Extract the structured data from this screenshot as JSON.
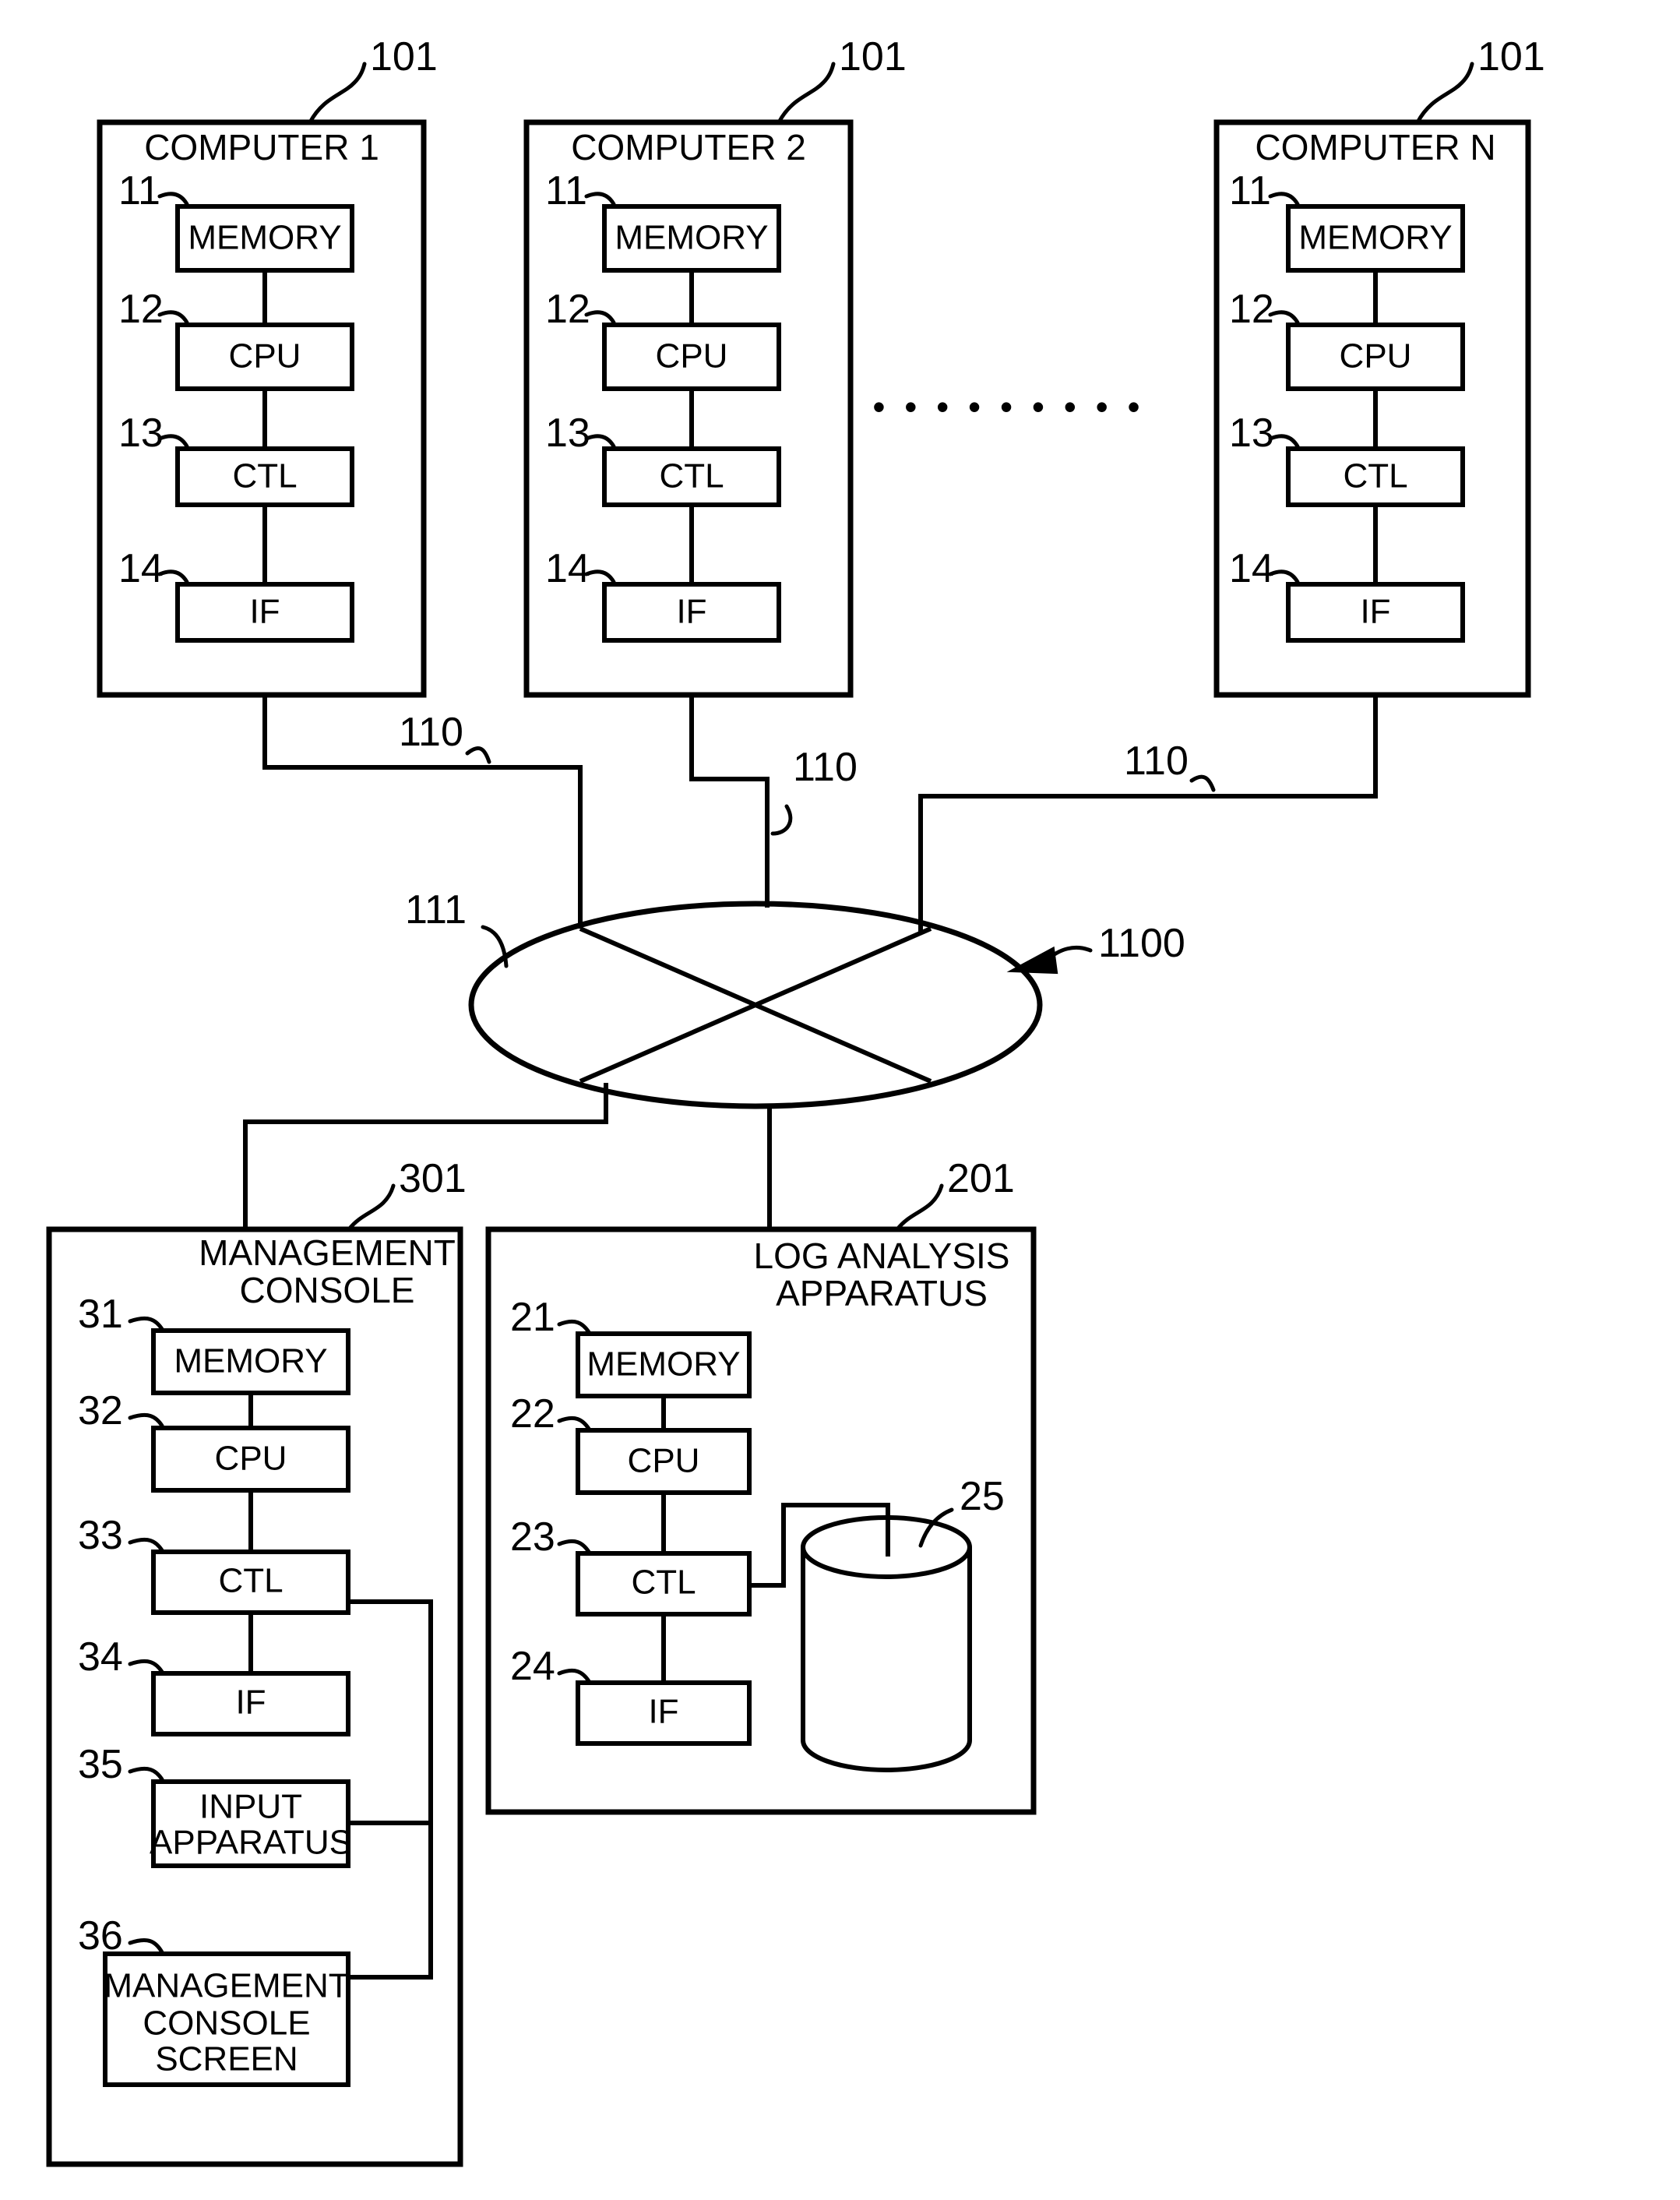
{
  "figure": {
    "title": "Log analysis system block diagram",
    "line_color": "#000000",
    "background": "#ffffff"
  },
  "computers": [
    {
      "ref": "101",
      "title": "COMPUTER 1",
      "blocks": [
        {
          "ref": "11",
          "label": "MEMORY"
        },
        {
          "ref": "12",
          "label": "CPU"
        },
        {
          "ref": "13",
          "label": "CTL"
        },
        {
          "ref": "14",
          "label": "IF"
        }
      ],
      "link_ref": "110"
    },
    {
      "ref": "101",
      "title": "COMPUTER 2",
      "blocks": [
        {
          "ref": "11",
          "label": "MEMORY"
        },
        {
          "ref": "12",
          "label": "CPU"
        },
        {
          "ref": "13",
          "label": "CTL"
        },
        {
          "ref": "14",
          "label": "IF"
        }
      ],
      "link_ref": "110"
    },
    {
      "ref": "101",
      "title": "COMPUTER N",
      "blocks": [
        {
          "ref": "11",
          "label": "MEMORY"
        },
        {
          "ref": "12",
          "label": "CPU"
        },
        {
          "ref": "13",
          "label": "CTL"
        },
        {
          "ref": "14",
          "label": "IF"
        }
      ],
      "link_ref": "110"
    }
  ],
  "ellipsis": "• • • • • • • • •",
  "network": {
    "ref": "111",
    "system_ref": "1100"
  },
  "management_console": {
    "ref": "301",
    "title_line1": "MANAGEMENT",
    "title_line2": "CONSOLE",
    "blocks": [
      {
        "ref": "31",
        "label": "MEMORY"
      },
      {
        "ref": "32",
        "label": "CPU"
      },
      {
        "ref": "33",
        "label": "CTL"
      },
      {
        "ref": "34",
        "label": "IF"
      },
      {
        "ref": "35",
        "label_line1": "INPUT",
        "label_line2": "APPARATUS"
      },
      {
        "ref": "36",
        "label_line1": "MANAGEMENT",
        "label_line2": "CONSOLE",
        "label_line3": "SCREEN"
      }
    ]
  },
  "log_analysis_apparatus": {
    "ref": "201",
    "title_line1": "LOG ANALYSIS",
    "title_line2": "APPARATUS",
    "blocks": [
      {
        "ref": "21",
        "label": "MEMORY"
      },
      {
        "ref": "22",
        "label": "CPU"
      },
      {
        "ref": "23",
        "label": "CTL"
      },
      {
        "ref": "24",
        "label": "IF"
      }
    ],
    "storage": {
      "ref": "25"
    }
  }
}
